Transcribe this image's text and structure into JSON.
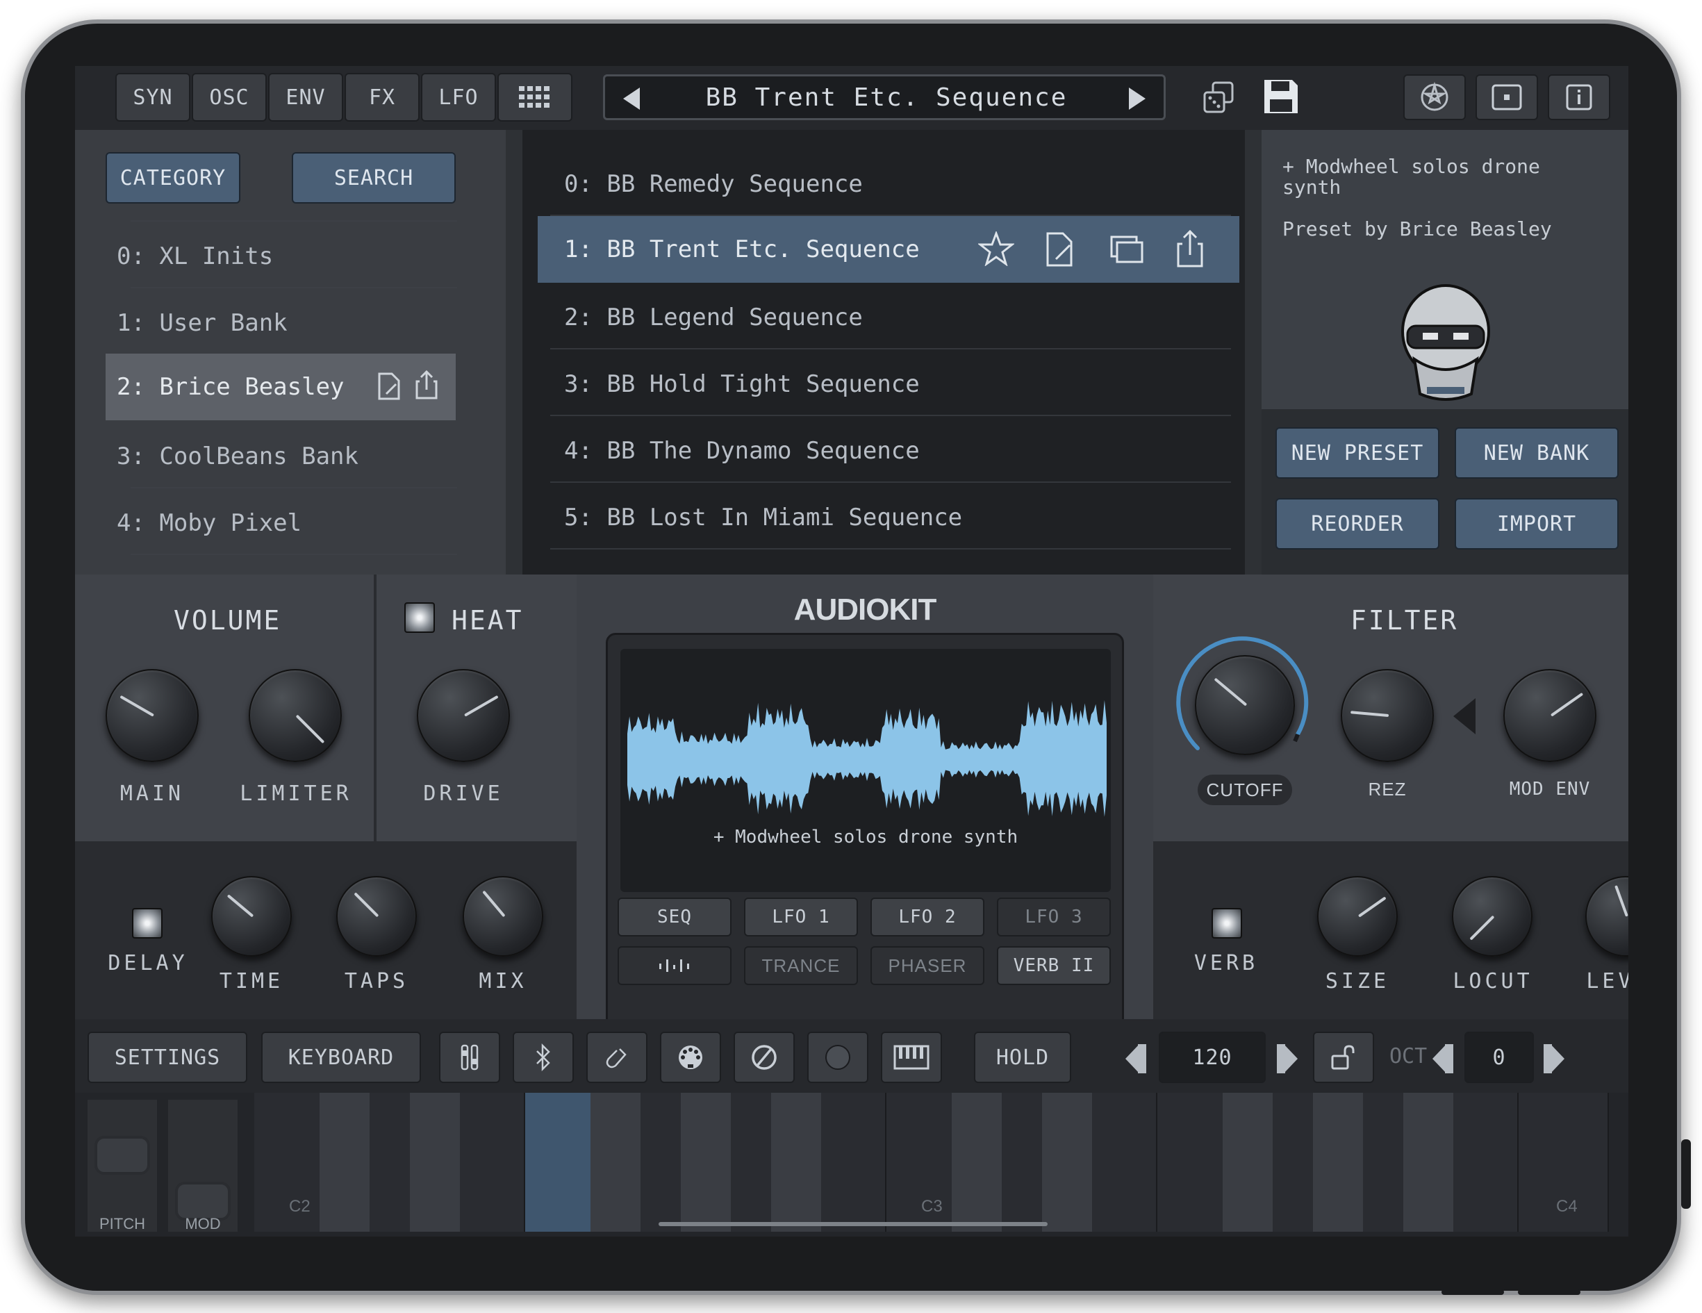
{
  "top_tabs": [
    "SYN",
    "OSC",
    "ENV",
    "FX",
    "LFO"
  ],
  "icons": {
    "grid": "grid-icon",
    "dice": "dice-icon",
    "save": "save-icon",
    "logo": "audiokit-icon",
    "window": "window-icon",
    "info": "info-icon"
  },
  "preset_nav": {
    "title": "BB Trent Etc. Sequence"
  },
  "bank_panel": {
    "category_label": "CATEGORY",
    "search_label": "SEARCH",
    "banks": [
      "0: XL Inits",
      "1: User Bank",
      "2: Brice Beasley",
      "3: CoolBeans Bank",
      "4: Moby Pixel"
    ],
    "selected_index": 2
  },
  "preset_list": {
    "presets": [
      "0: BB Remedy Sequence",
      "1: BB Trent Etc. Sequence",
      "2: BB Legend Sequence",
      "3: BB Hold Tight Sequence",
      "4: BB The Dynamo Sequence",
      "5: BB Lost In Miami Sequence"
    ],
    "selected_index": 1
  },
  "info_panel": {
    "description": "+ Modwheel solos drone synth",
    "author": "Preset by Brice Beasley",
    "new_preset": "NEW PRESET",
    "new_bank": "NEW BANK",
    "reorder": "REORDER",
    "import": "IMPORT"
  },
  "volume": {
    "title": "VOLUME",
    "main_label": "MAIN",
    "limiter_label": "LIMITER"
  },
  "heat": {
    "title": "HEAT",
    "drive_label": "DRIVE"
  },
  "display": {
    "brand": "AUDIOKIT",
    "caption": "+ Modwheel solos drone synth",
    "row1": [
      "SEQ",
      "LFO 1",
      "LFO 2",
      "LFO 3"
    ],
    "row2": [
      "TRANCE",
      "PHASER",
      "VERB II"
    ],
    "accent": "#8cc4e8"
  },
  "filter": {
    "title": "FILTER",
    "cutoff_label": "CUTOFF",
    "rez_label": "REZ",
    "modenv_label": "MOD ENV"
  },
  "delay": {
    "label": "DELAY",
    "time_label": "TIME",
    "taps_label": "TAPS",
    "mix_label": "MIX"
  },
  "reverb": {
    "label": "VERB",
    "size_label": "SIZE",
    "locut_label": "LOCUT",
    "level_label": "LEVEL"
  },
  "bottom_bar": {
    "settings": "SETTINGS",
    "keyboard": "KEYBOARD",
    "hold": "HOLD",
    "tempo": "120",
    "oct_label": "OCT",
    "octave": "0"
  },
  "keyboard": {
    "pitch": "PITCH",
    "mod": "MOD",
    "c2": "C2",
    "c3": "C3",
    "c4": "C4"
  }
}
